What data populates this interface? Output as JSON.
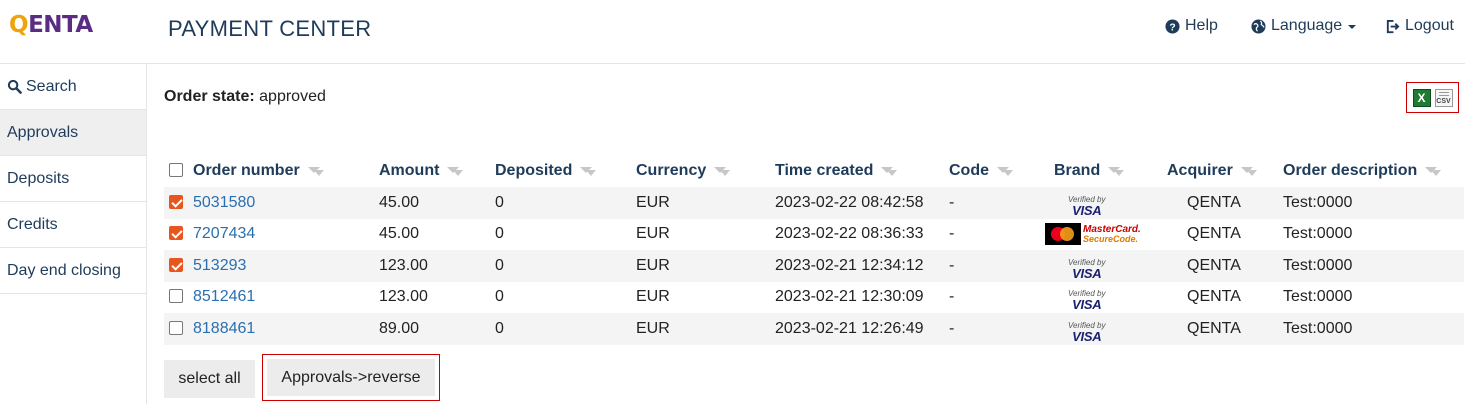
{
  "header": {
    "logo_q": "Q",
    "logo_rest": "ENTA",
    "title": "PAYMENT CENTER",
    "help_label": "Help",
    "language_label": "Language",
    "logout_label": "Logout"
  },
  "sidebar": {
    "items": [
      {
        "label": "Search",
        "icon": "search-icon"
      },
      {
        "label": "Approvals",
        "active": true
      },
      {
        "label": "Deposits"
      },
      {
        "label": "Credits"
      },
      {
        "label": "Day end closing"
      }
    ]
  },
  "filter": {
    "state_label": "Order state:",
    "state_value": "approved"
  },
  "export": {
    "xls_icon": "excel-icon",
    "xls_glyph": "X",
    "csv_icon": "csv-icon",
    "csv_glyph": "CSV"
  },
  "table": {
    "columns": [
      "Order number",
      "Amount",
      "Deposited",
      "Currency",
      "Time created",
      "Code",
      "Brand",
      "Acquirer",
      "Order description"
    ],
    "rows": [
      {
        "checked": true,
        "order": "5031580",
        "amount": "45.00",
        "deposited": "0",
        "currency": "EUR",
        "time": "2023-02-22 08:42:58",
        "code": "-",
        "brand": "visa",
        "acquirer": "QENTA",
        "description": "Test:0000"
      },
      {
        "checked": true,
        "order": "7207434",
        "amount": "45.00",
        "deposited": "0",
        "currency": "EUR",
        "time": "2023-02-22 08:36:33",
        "code": "-",
        "brand": "mastercard",
        "acquirer": "QENTA",
        "description": "Test:0000"
      },
      {
        "checked": true,
        "order": "513293",
        "amount": "123.00",
        "deposited": "0",
        "currency": "EUR",
        "time": "2023-02-21 12:34:12",
        "code": "-",
        "brand": "visa",
        "acquirer": "QENTA",
        "description": "Test:0000"
      },
      {
        "checked": false,
        "order": "8512461",
        "amount": "123.00",
        "deposited": "0",
        "currency": "EUR",
        "time": "2023-02-21 12:30:09",
        "code": "-",
        "brand": "visa",
        "acquirer": "QENTA",
        "description": "Test:0000"
      },
      {
        "checked": false,
        "order": "8188461",
        "amount": "89.00",
        "deposited": "0",
        "currency": "EUR",
        "time": "2023-02-21 12:26:49",
        "code": "-",
        "brand": "visa",
        "acquirer": "QENTA",
        "description": "Test:0000"
      }
    ],
    "brand_text": {
      "visa_top": "Verified by",
      "visa_bottom": "VISA",
      "mc_top": "MasterCard.",
      "mc_bottom": "SecureCode."
    }
  },
  "actions": {
    "select_all_label": "select all",
    "reverse_label": "Approvals->reverse"
  },
  "colors": {
    "nav_text": "#1f3b5a",
    "link": "#2a6fb0",
    "checkbox_checked": "#e8561e",
    "highlight_border": "#cc0000"
  }
}
